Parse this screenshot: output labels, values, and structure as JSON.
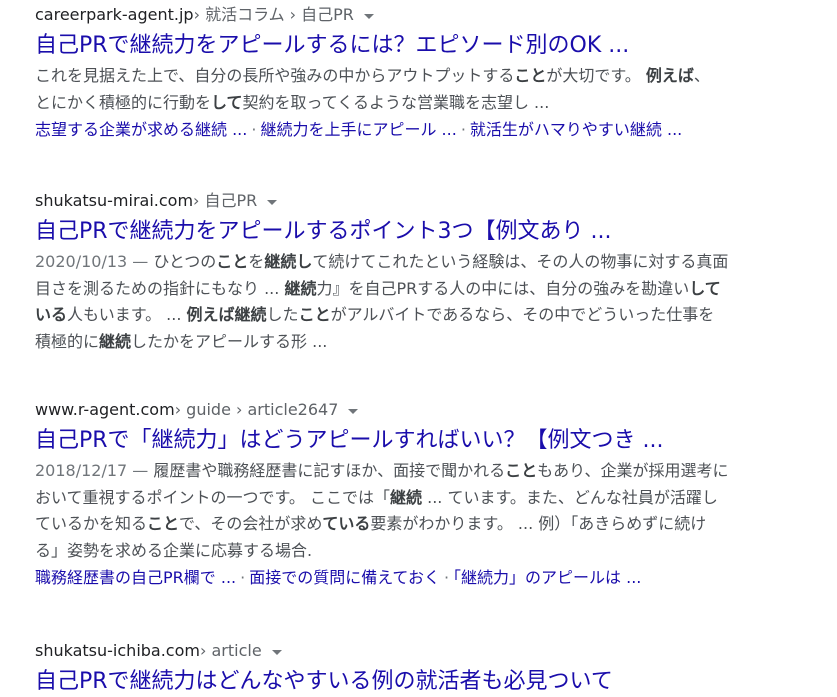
{
  "results": [
    {
      "domain": "careerpark-agent.jp",
      "path": " › 就活コラム › 自己PR",
      "title": "自己PRで継続力をアピールするには？エピソード別のOK ...",
      "snippet_lines": [
        [
          {
            "t": "これを見据えた上で、自分の長所や強みの中からアウトプットする"
          },
          {
            "t": "こと",
            "b": true
          },
          {
            "t": "が大切です。 "
          },
          {
            "t": "例えば",
            "b": true
          },
          {
            "t": "、"
          }
        ],
        [
          {
            "t": "とにかく積極的に行動を"
          },
          {
            "t": "して",
            "b": true
          },
          {
            "t": "契約を取ってくるような営業職を志望し ..."
          }
        ]
      ],
      "sitelinks": [
        "志望する企業が求める継続 ...",
        "継続力を上手にアピール ...",
        "就活生がハマりやすい継続 ..."
      ]
    },
    {
      "domain": "shukatsu-mirai.com",
      "path": " › 自己PR",
      "title": "自己PRで継続力をアピールするポイント3つ【例文あり ...",
      "snippet_lines": [
        [
          {
            "t": "2020/10/13 — ",
            "d": true
          },
          {
            "t": "ひとつの"
          },
          {
            "t": "こと",
            "b": true
          },
          {
            "t": "を"
          },
          {
            "t": "継続し",
            "b": true
          },
          {
            "t": "て続けてこれたという経験は、その人の物事に対する真面"
          }
        ],
        [
          {
            "t": "目さを測るための指針にもなり ... "
          },
          {
            "t": "継続",
            "b": true
          },
          {
            "t": "力』を自己PRする人の中には、自分の強みを勘違い"
          },
          {
            "t": "して",
            "b": true
          }
        ],
        [
          {
            "t": "いる",
            "b": true
          },
          {
            "t": "人もいます。 ... "
          },
          {
            "t": "例えば継続",
            "b": true
          },
          {
            "t": "した"
          },
          {
            "t": "こと",
            "b": true
          },
          {
            "t": "がアルバイトであるなら、その中でどういった仕事を"
          }
        ],
        [
          {
            "t": "積極的に"
          },
          {
            "t": "継続",
            "b": true
          },
          {
            "t": "したかをアピールする形 ..."
          }
        ]
      ],
      "sitelinks": []
    },
    {
      "domain": "www.r-agent.com",
      "path": " › guide › article2647",
      "title": "自己PRで「継続力」はどうアピールすればいい？【例文つき ...",
      "snippet_lines": [
        [
          {
            "t": "2018/12/17 — ",
            "d": true
          },
          {
            "t": "履歴書や職務経歴書に記すほか、面接で聞かれる"
          },
          {
            "t": "こと",
            "b": true
          },
          {
            "t": "もあり、企業が採用選考に"
          }
        ],
        [
          {
            "t": "おいて重視するポイントの一つです。 ここでは「"
          },
          {
            "t": "継続",
            "b": true
          },
          {
            "t": " ... ています。また、どんな社員が活躍し"
          }
        ],
        [
          {
            "t": "ているかを知る"
          },
          {
            "t": "こと",
            "b": true
          },
          {
            "t": "で、その会社が求め"
          },
          {
            "t": "ている",
            "b": true
          },
          {
            "t": "要素がわかります。 ... 例）「あきらめずに続け"
          }
        ],
        [
          {
            "t": "る」姿勢を求める企業に応募する場合."
          }
        ]
      ],
      "sitelinks": [
        "職務経歴書の自己PR欄で ...",
        "面接での質問に備えておく",
        "「継続力」のアピールは ..."
      ]
    },
    {
      "domain": "shukatsu-ichiba.com",
      "path": " › article",
      "title": "自己PRで継続力はどんなやすいる例の就活者も必見ついて",
      "snippet_lines": [],
      "sitelinks": []
    }
  ]
}
